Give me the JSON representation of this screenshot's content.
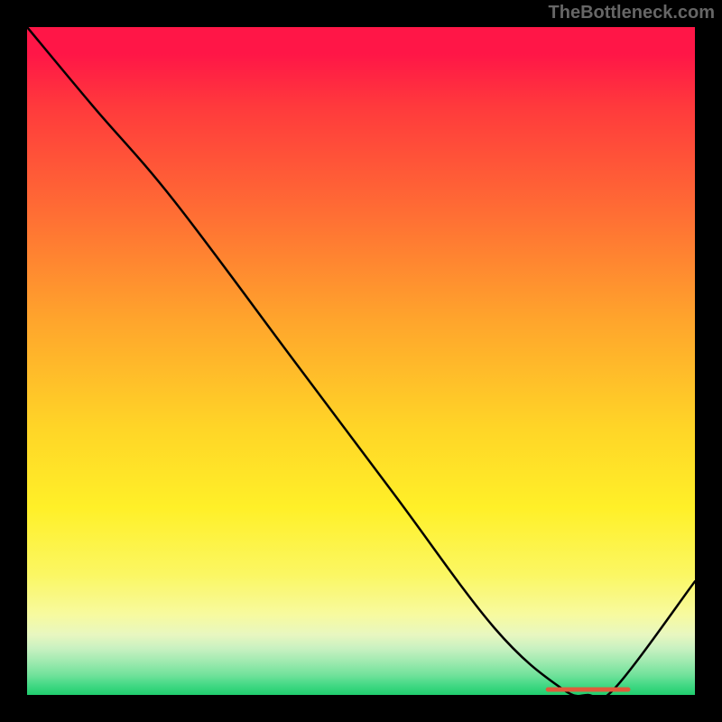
{
  "watermark": "TheBottleneck.com",
  "chart_data": {
    "type": "line",
    "title": "",
    "xlabel": "",
    "ylabel": "",
    "xlim": [
      0,
      100
    ],
    "ylim": [
      0,
      100
    ],
    "grid": false,
    "legend": false,
    "series": [
      {
        "name": "bottleneck-curve",
        "x": [
          0,
          10,
          22,
          40,
          55,
          70,
          80,
          84,
          88,
          100
        ],
        "values": [
          100,
          88,
          74,
          50,
          30,
          10,
          1,
          0,
          1,
          17
        ]
      }
    ],
    "optimal_region": {
      "x_start": 78,
      "x_end": 90,
      "label": ""
    },
    "gradient_meaning": "top=red=high bottleneck, bottom=green=no bottleneck",
    "notes": "Curve descends from top-left, slight knee around x≈22, reaches minimum near x≈84, then rises again toward the right edge."
  }
}
